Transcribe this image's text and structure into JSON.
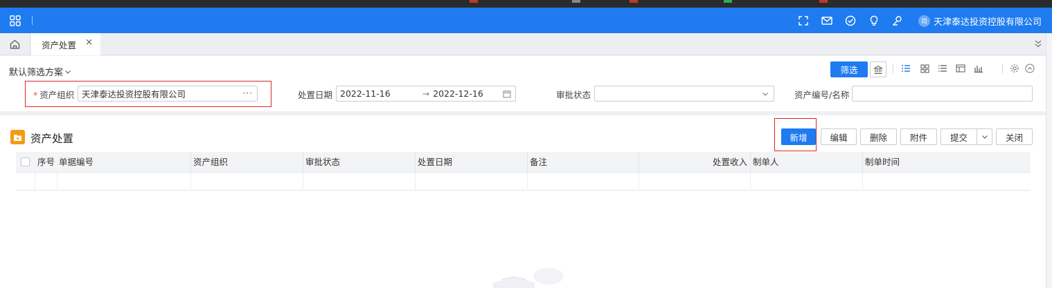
{
  "header": {
    "company_badge": "司",
    "company_name": "天津泰达投资控股有限公司",
    "icons": [
      "fullscreen-icon",
      "mail-icon",
      "check-circle-icon",
      "bulb-icon",
      "user-search-icon"
    ]
  },
  "tabs": [
    {
      "label": "资产处置",
      "close": "×"
    }
  ],
  "filter": {
    "scheme_label": "默认筛选方案",
    "filter_button": "筛选",
    "fields": {
      "asset_org": {
        "required_mark": "*",
        "label": "资产组织",
        "value": "天津泰达投资控股有限公司",
        "more": "···"
      },
      "disposal_date": {
        "label": "处置日期",
        "start": "2022-11-16",
        "arrow": "→",
        "end": "2022-12-16"
      },
      "approval_status": {
        "label": "审批状态",
        "value": ""
      },
      "asset_code": {
        "label": "资产编号/名称",
        "value": ""
      }
    }
  },
  "panel": {
    "title": "资产处置",
    "buttons": {
      "add": "新增",
      "edit": "编辑",
      "delete": "删除",
      "attach": "附件",
      "submit": "提交",
      "close": "关闭"
    }
  },
  "table": {
    "columns": [
      "序号",
      "单据编号",
      "资产组织",
      "审批状态",
      "处置日期",
      "备注",
      "处置收入",
      "制单人",
      "制单时间"
    ],
    "rows": []
  },
  "colors": {
    "brand": "#1e7bf0",
    "highlight_box": "#e02424",
    "panel_icon": "#f39c12"
  }
}
